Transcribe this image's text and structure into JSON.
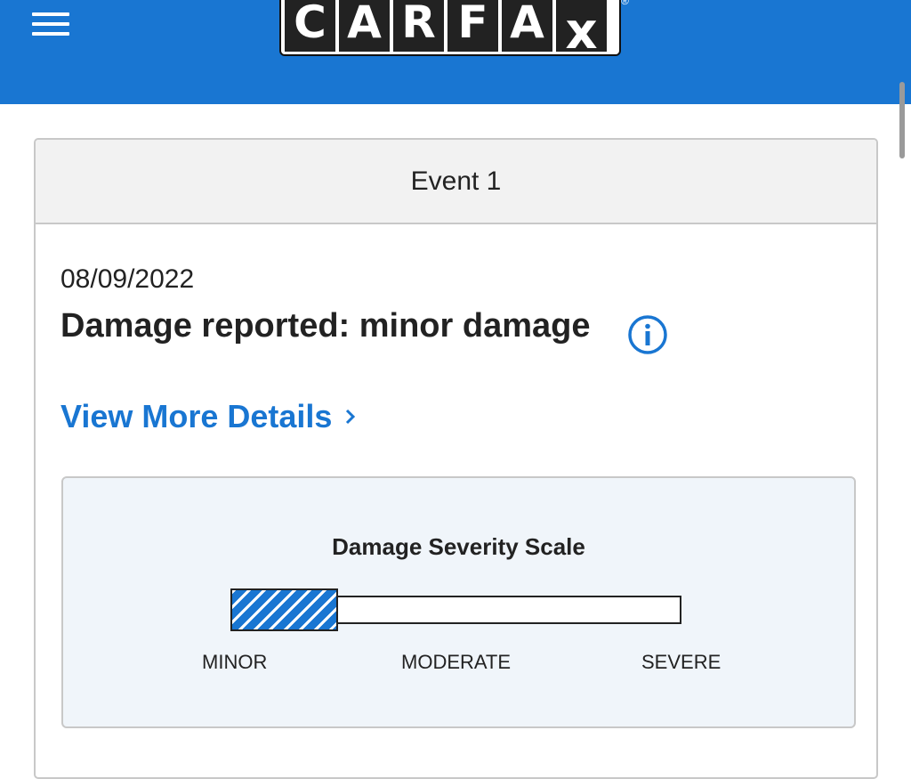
{
  "header": {
    "brand": [
      "C",
      "A",
      "R",
      "F",
      "A",
      "X"
    ],
    "registered_mark": "®",
    "menu_icon": "hamburger-menu-icon",
    "background_color": "#1976d2"
  },
  "event": {
    "title": "Event 1",
    "date": "08/09/2022",
    "damage_text": "Damage reported: minor damage",
    "info_icon": "info-circle-icon",
    "view_more_label": "View More Details",
    "view_more_icon": "chevron-right-icon",
    "link_color": "#1976d2"
  },
  "severity_scale": {
    "title": "Damage Severity Scale",
    "labels": [
      "MINOR",
      "MODERATE",
      "SEVERE"
    ],
    "level": "MINOR",
    "fill_fraction": 0.24,
    "fill_color": "#1976d2"
  }
}
